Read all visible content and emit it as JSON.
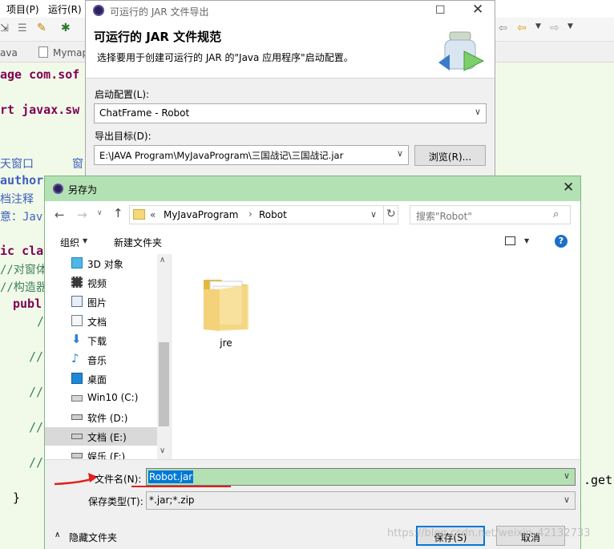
{
  "eclipse": {
    "menu": [
      "项目(P)",
      "运行(R)"
    ],
    "tabs": [
      "ava",
      "Mymap"
    ],
    "code_lines": {
      "l1": "age com.sof",
      "l2": "rt javax.sw",
      "l3a": "天窗口",
      "l3b": "窗",
      "l4": "author",
      "l5": "档注释",
      "l6": "意：Jav",
      "l7": "ic cla",
      "l8": "//对窗体",
      "l9": "//构造器",
      "l10": "publ",
      "l11": "/",
      "l12": "//",
      "l13": "//",
      "l14": "//",
      "l15": "//",
      "l16": "}",
      "right": ".get"
    }
  },
  "jar_dialog": {
    "title": "可运行的 JAR 文件导出",
    "heading": "可运行的 JAR 文件规范",
    "description": "选择要用于创建可运行的 JAR 的\"Java 应用程序\"启动配置。",
    "launch_label": "启动配置(L):",
    "launch_value": "ChatFrame - Robot",
    "export_label": "导出目标(D):",
    "export_value": "E:\\JAVA Program\\MyJavaProgram\\三国战记\\三国战记.jar",
    "browse": "浏览(R)..."
  },
  "save_dialog": {
    "title": "另存为",
    "breadcrumb": [
      "«",
      "MyJavaProgram",
      "Robot"
    ],
    "search_placeholder": "搜索\"Robot\"",
    "organize": "组织",
    "new_folder": "新建文件夹",
    "nav_items": [
      {
        "label": "3D 对象",
        "icon": "3d-objects-icon"
      },
      {
        "label": "视频",
        "icon": "video-icon"
      },
      {
        "label": "图片",
        "icon": "pictures-icon"
      },
      {
        "label": "文档",
        "icon": "documents-icon"
      },
      {
        "label": "下载",
        "icon": "download-icon"
      },
      {
        "label": "音乐",
        "icon": "music-icon"
      },
      {
        "label": "桌面",
        "icon": "desktop-icon"
      },
      {
        "label": "Win10 (C:)",
        "icon": "drive-c-icon"
      },
      {
        "label": "软件 (D:)",
        "icon": "drive-icon"
      },
      {
        "label": "文档 (E:)",
        "icon": "drive-icon"
      },
      {
        "label": "娱乐 (F:)",
        "icon": "drive-icon"
      }
    ],
    "files": [
      {
        "name": "jre"
      }
    ],
    "filename_label": "文件名(N):",
    "filename_value": "Robot.jar",
    "filetype_label": "保存类型(T):",
    "filetype_value": "*.jar;*.zip",
    "hide_folders": "隐藏文件夹",
    "save": "保存(S)",
    "cancel": "取消"
  },
  "watermark": "https://blog.csdn.net/weixin_42132733",
  "colors": {
    "title_green": "#b3e1b3",
    "editor_bg": "#f1fae8",
    "select_blue": "#0078d7",
    "arrow_red": "#e02020"
  }
}
